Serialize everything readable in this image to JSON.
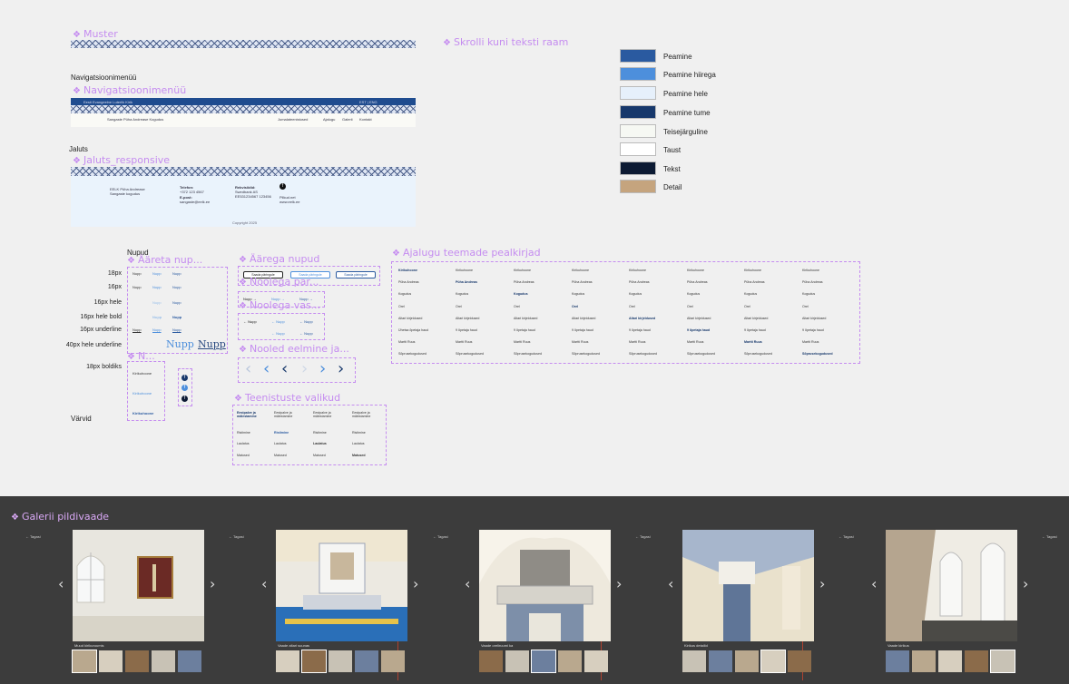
{
  "frames": {
    "muster": "Muster",
    "scroll": "Skrolli kuni teksti raam",
    "nav_plain": "Navigatsioonimenüü",
    "nav": "Navigatsioonimenüü",
    "jaluts_plain": "Jaluts",
    "jaluts": "Jaluts_responsive",
    "nupud_plain": "Nupud",
    "aareta": "Ääreta nup...",
    "aarega": "Äärega nupud",
    "noolega_par": "Noolega par...",
    "noolega_vas": "Noolega vas...",
    "nooled": "Nooled eelmine ja...",
    "n_short": "N...",
    "teenistused": "Teenistuste valikud",
    "ajalugu": "Ajalugu teemade pealkirjad",
    "galerii": "Galerii pildivaade",
    "varvid": "Värvid"
  },
  "nav_bar": {
    "site": "Eesti Evangeelne Luterlik Kirik",
    "lang": "EST | ENG",
    "church": "Sangaste Püha Andrease Kogudus",
    "items": [
      "Jumalateenistused",
      "Ajalugu",
      "Galerii",
      "Kontakt"
    ]
  },
  "footer": {
    "addr": [
      "EELK Püha Andrease",
      "Sangaste kogudus"
    ],
    "phone_label": "Telefon:",
    "phone": "+372 123 4567",
    "email_label": "E-post:",
    "email": "sangaste@eelk.ee",
    "bank_label": "Rekvisiidid:",
    "bank": [
      "Swedbank AS",
      "EE531234567 123456"
    ],
    "web": [
      "Pilkud.net",
      "www.eelk.ee"
    ],
    "copyright": "Copyright 2025"
  },
  "button_rows": [
    "18px",
    "16px",
    "16px hele",
    "16px hele bold",
    "16px underline",
    "40px hele underline",
    "18px boldiks"
  ],
  "nupp": "Nupp",
  "bordered_label": "Saada päringule",
  "arrow_label": "Nupp",
  "kirikuhoone": "Kirikuhoone",
  "teenistused": {
    "cols": 4,
    "rows": [
      "Eestpalve ja mälestamine",
      "Ristimine",
      "Laulatus",
      "Matused"
    ]
  },
  "ajalugu": {
    "rows": [
      "Kirikuhoone",
      "Püha Andreas",
      "Kogudus",
      "Orel",
      "Altari kirjeldused",
      "Ühetsa õpetaja haud",
      "Martti Ruus",
      "Sõprusekogudused"
    ],
    "rows_alt": [
      "Kirikuhoone",
      "Püha Andreas",
      "Kogudus",
      "Orel",
      "Altari kirjeldused",
      "9 õpetaja haud",
      "Martti Ruus",
      "Sõprusekogudused"
    ]
  },
  "colors": [
    {
      "name": "Peamine",
      "hex": "#2a5aa0"
    },
    {
      "name": "Peamine hiirega",
      "hex": "#4d8fdc"
    },
    {
      "name": "Peamine hele",
      "hex": "#e6f0fb"
    },
    {
      "name": "Peamine tume",
      "hex": "#17386b"
    },
    {
      "name": "Teisejärguline",
      "hex": "#f6f8f3"
    },
    {
      "name": "Taust",
      "hex": "#ffffff"
    },
    {
      "name": "Tekst",
      "hex": "#0c1a33"
    },
    {
      "name": "Detail",
      "hex": "#c5a47e"
    }
  ],
  "gallery": {
    "back": "Tagasi",
    "captions": [
      "Muud kirikuruumis",
      "Vaade altari suunas",
      "Vaade oreliruumi ka",
      "Kirikus detailid",
      "Vaade kirikus"
    ]
  }
}
